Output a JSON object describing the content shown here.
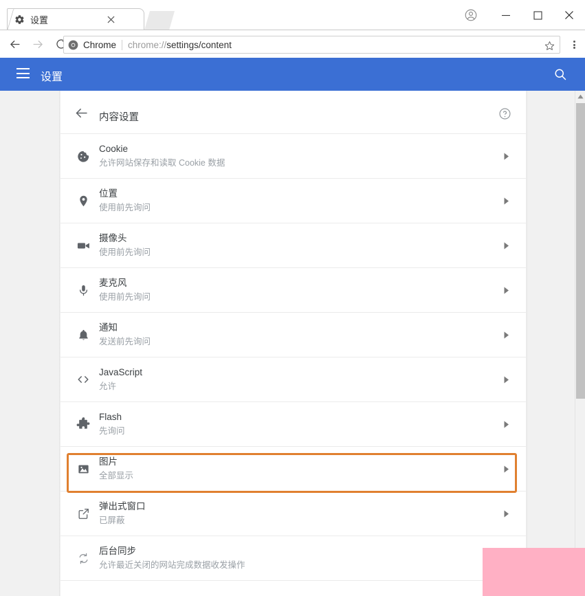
{
  "window": {
    "tab": {
      "title": "设置",
      "favicon": "gear-icon",
      "close": "×"
    },
    "controls": {
      "profile": "profile-avatar-icon",
      "minimize": "−",
      "maximize": "□",
      "close": "✕"
    }
  },
  "toolbar": {
    "back": "back-arrow-icon",
    "forward": "forward-arrow-icon",
    "reload": "reload-icon",
    "omnibox": {
      "scheme_label": "Chrome",
      "url_prefix": "chrome://",
      "url_bold": "settings/content",
      "url_full": "chrome://settings/content",
      "star": "bookmark-star-icon"
    },
    "menu": "three-dot-menu-icon"
  },
  "settings_header": {
    "menu": "hamburger-icon",
    "title": "设置",
    "search": "search-icon"
  },
  "content": {
    "back": "back-arrow-icon",
    "title": "内容设置",
    "help": "help-circle-icon",
    "items": [
      {
        "icon": "cookie-icon",
        "title": "Cookie",
        "sub": "允许网站保存和读取 Cookie 数据",
        "chevron": "▶"
      },
      {
        "icon": "location-pin-icon",
        "title": "位置",
        "sub": "使用前先询问",
        "chevron": "▶"
      },
      {
        "icon": "camera-icon",
        "title": "摄像头",
        "sub": "使用前先询问",
        "chevron": "▶"
      },
      {
        "icon": "microphone-icon",
        "title": "麦克风",
        "sub": "使用前先询问",
        "chevron": "▶"
      },
      {
        "icon": "bell-icon",
        "title": "通知",
        "sub": "发送前先询问",
        "chevron": "▶"
      },
      {
        "icon": "code-brackets-icon",
        "title": "JavaScript",
        "sub": "允许",
        "chevron": "▶"
      },
      {
        "icon": "puzzle-piece-icon",
        "title": "Flash",
        "sub": "先询问",
        "chevron": "▶"
      },
      {
        "icon": "image-icon",
        "title": "图片",
        "sub": "全部显示",
        "chevron": "▶"
      },
      {
        "icon": "popup-window-icon",
        "title": "弹出式窗口",
        "sub": "已屏蔽",
        "chevron": "▶"
      },
      {
        "icon": "sync-icon",
        "title": "后台同步",
        "sub": "允许最近关闭的网站完成数据收发操作",
        "chevron": "▶"
      }
    ],
    "highlighted_item_index": 5,
    "highlight_color": "#e08030"
  },
  "scrollbar": {
    "up_arrow": "▲"
  },
  "overlay": {
    "type": "redaction-box",
    "color": "#ffb0c4"
  },
  "colors": {
    "header_blue": "#3b6fd4",
    "page_background": "#f1f1f1",
    "card_background": "#ffffff",
    "title_text": "#3c4043",
    "subtitle_text": "#9aa0a6",
    "highlight_orange": "#e08030",
    "overlay_pink": "#ffb0c4"
  }
}
